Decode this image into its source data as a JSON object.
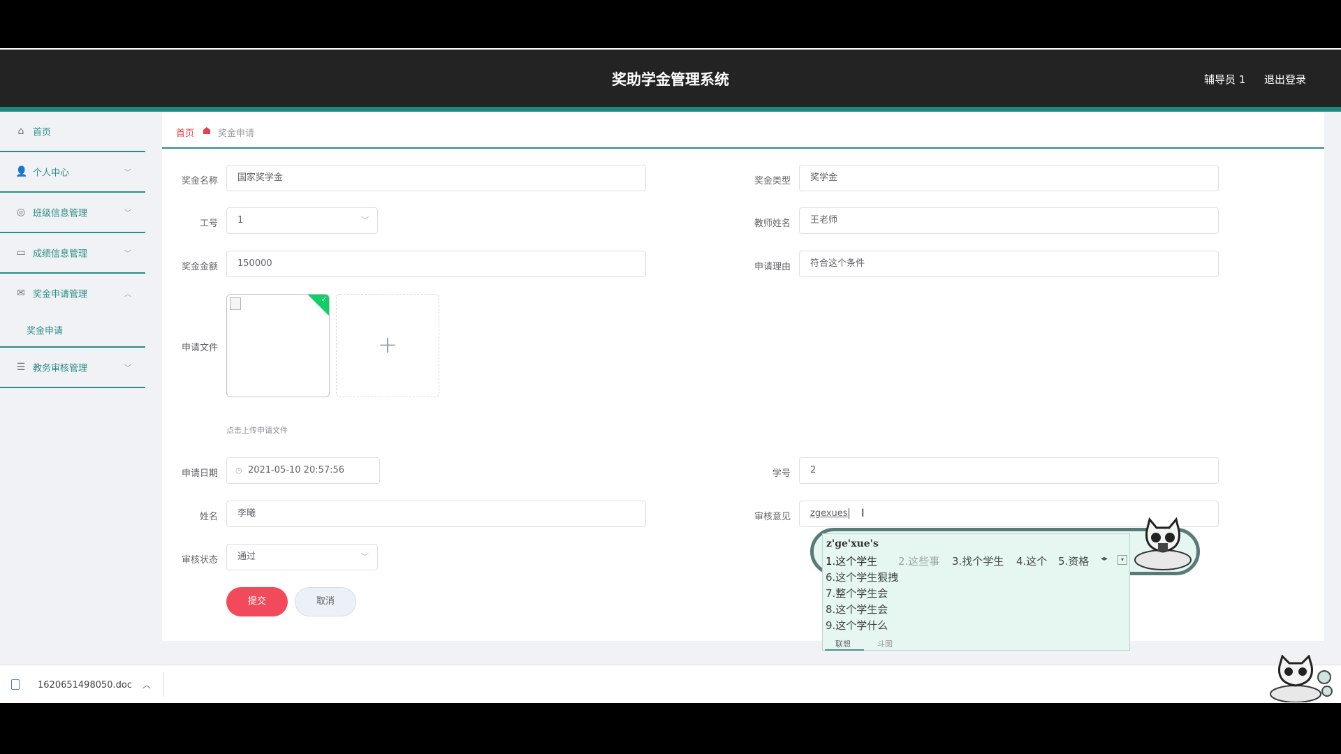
{
  "header": {
    "title": "奖助学金管理系统",
    "user": "辅导员 1",
    "logout": "退出登录"
  },
  "sidebar": {
    "items": [
      {
        "label": "首页",
        "icon": "home-icon"
      },
      {
        "label": "个人中心",
        "icon": "user-icon"
      },
      {
        "label": "班级信息管理",
        "icon": "circle-icon"
      },
      {
        "label": "成绩信息管理",
        "icon": "chat-icon"
      },
      {
        "label": "奖金申请管理",
        "icon": "mail-icon"
      },
      {
        "label": "教务审核管理",
        "icon": "list-icon"
      }
    ],
    "sub_item": "奖金申请"
  },
  "breadcrumb": {
    "home": "首页",
    "current": "奖金申请"
  },
  "form": {
    "award_name": {
      "label": "奖金名称",
      "value": "国家奖学金"
    },
    "award_type": {
      "label": "奖金类型",
      "value": "奖学金"
    },
    "staff_id": {
      "label": "工号",
      "value": "1"
    },
    "teacher_name": {
      "label": "教师姓名",
      "value": "王老师"
    },
    "amount": {
      "label": "奖金金额",
      "value": "150000"
    },
    "reason": {
      "label": "申请理由",
      "value": "符合这个条件"
    },
    "file": {
      "label": "申请文件",
      "tip": "点击上传申请文件"
    },
    "apply_date": {
      "label": "申请日期",
      "value": "2021-05-10 20:57:56"
    },
    "student_no": {
      "label": "学号",
      "value": "2"
    },
    "name": {
      "label": "姓名",
      "value": "李曦"
    },
    "review_opinion": {
      "label": "审核意见",
      "value": "zgexues"
    },
    "review_status": {
      "label": "审核状态",
      "value": "通过"
    }
  },
  "buttons": {
    "submit": "提交",
    "cancel": "取消"
  },
  "ime": {
    "pinyin": "z'ge'xue's",
    "candidates_row": [
      {
        "text": "1.这个学生",
        "active": true
      },
      {
        "text": "2.这些事",
        "active": false
      },
      {
        "text": "3.找个学生",
        "active": false
      },
      {
        "text": "4.这个",
        "active": false
      },
      {
        "text": "5.资格",
        "active": false
      }
    ],
    "candidates_list": [
      "6.这个学生狠拽",
      "7.整个学生会",
      "8.这个学生会",
      "9.这个学什么"
    ],
    "tabs": [
      "联想",
      "斗图"
    ]
  },
  "download": {
    "filename": "1620651498050.doc"
  },
  "colors": {
    "accent": "#1a8a82",
    "primary": "#f24a5a",
    "sidebar_text": "#2a8c86"
  }
}
